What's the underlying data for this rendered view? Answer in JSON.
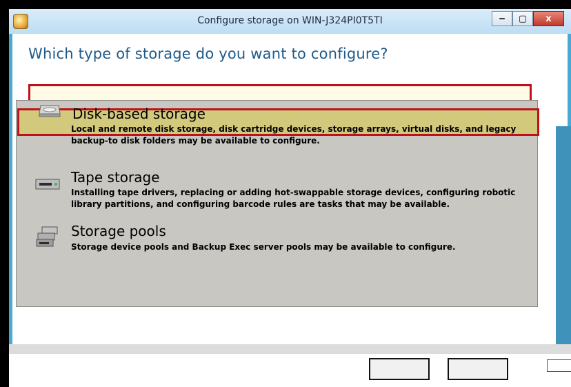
{
  "window": {
    "title": "Configure storage on WIN-J324PI0T5TI",
    "minimize_glyph": "‒",
    "maximize_glyph": "▢",
    "close_glyph": "x"
  },
  "page": {
    "heading": "Which type of storage do you want to configure?"
  },
  "options": [
    {
      "title": "Disk-based storage",
      "description_1": "Local and remote disk storage, disk cartridge devices, storage arrays, virtual disks, and legacy",
      "description_2": "backup-to disk folders may be available to configure.",
      "icon": "disk-drive-icon",
      "selected": true
    },
    {
      "title": "Tape storage",
      "description_1": "Installing tape drivers, replacing or adding hot-swappable storage devices, configuring robotic",
      "description_2": "library partitions, and configuring barcode rules are tasks that may be available.",
      "icon": "tape-drive-icon",
      "selected": false
    },
    {
      "title": "Storage pools",
      "description_1": "Storage device pools and Backup Exec server pools may be available to configure.",
      "description_2": "",
      "icon": "storage-pool-icon",
      "selected": false
    }
  ],
  "footer": {
    "help_link": "",
    "next_label": "",
    "cancel_label": "",
    "corner_label": ""
  },
  "colors": {
    "selection_border": "#c0101c",
    "heading": "#1f5a8a",
    "panel": "#c9c7c2"
  }
}
